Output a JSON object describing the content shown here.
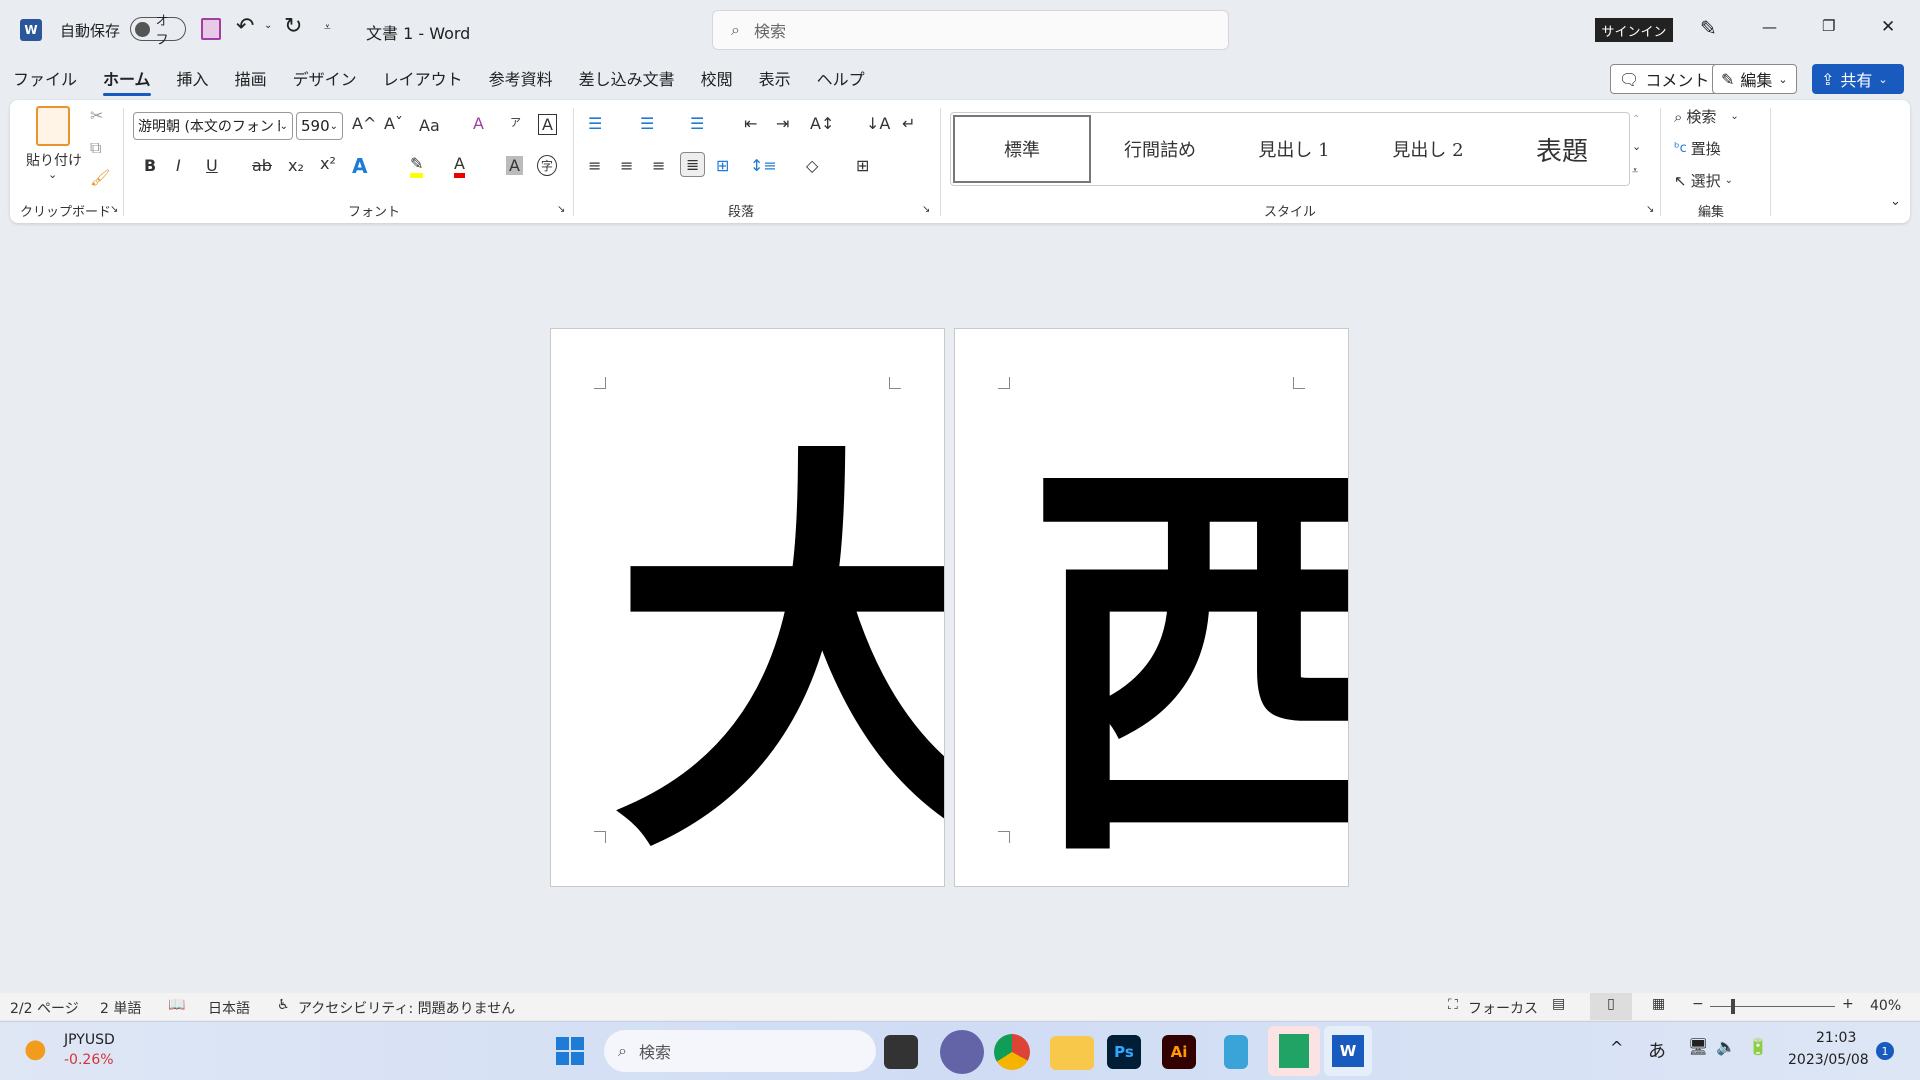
{
  "titlebar": {
    "autosave_label": "自動保存",
    "autosave_state": "オフ",
    "doc_title": "文書 1  -  Word",
    "search_placeholder": "検索",
    "signin": "サインイン",
    "minimize": "—",
    "restore": "❐",
    "close": "✕"
  },
  "menu": {
    "tabs": [
      "ファイル",
      "ホーム",
      "挿入",
      "描画",
      "デザイン",
      "レイアウト",
      "参考資料",
      "差し込み文書",
      "校閲",
      "表示",
      "ヘルプ"
    ],
    "active": "ホーム",
    "comment": "コメント",
    "edit": "編集",
    "share": "共有"
  },
  "ribbon": {
    "clipboard": {
      "paste": "貼り付け",
      "label": "クリップボード"
    },
    "font": {
      "name": "游明朝 (本文のフォント",
      "size": "590",
      "label": "フォント",
      "grow": "A^",
      "shrink": "Aˇ",
      "case": "Aa",
      "bold": "B",
      "italic": "I",
      "underline": "U",
      "strike": "ab",
      "sub": "x₂",
      "sup": "x²",
      "clear": "A",
      "phonetic": "ア",
      "border_char": "A",
      "shade_char": "A",
      "enclose": "字"
    },
    "paragraph": {
      "label": "段落"
    },
    "styles": {
      "label": "スタイル",
      "items": [
        "標準",
        "行間詰め",
        "見出し 1",
        "見出し 2",
        "表題"
      ],
      "selected": "標準"
    },
    "editing": {
      "label": "編集",
      "find": "検索",
      "replace": "置換",
      "select": "選択"
    }
  },
  "document": {
    "pages": [
      {
        "text": "大"
      },
      {
        "text": "西"
      }
    ]
  },
  "status": {
    "page": "2/2 ページ",
    "words": "2 単語",
    "language": "日本語",
    "accessibility": "アクセシビリティ: 問題ありません",
    "focus": "フォーカス",
    "zoom": "40%",
    "zoom_level": 0.4
  },
  "taskbar": {
    "ticker": "JPYUSD",
    "change": "-0.26%",
    "search": "検索",
    "time": "21:03",
    "date": "2023/05/08",
    "notifications": "1",
    "ime": "あ",
    "apps": [
      "Ps",
      "Ai",
      "W"
    ]
  },
  "colors": {
    "accent": "#185abd",
    "negative": "#d13438",
    "word_blue": "#2b579a"
  }
}
